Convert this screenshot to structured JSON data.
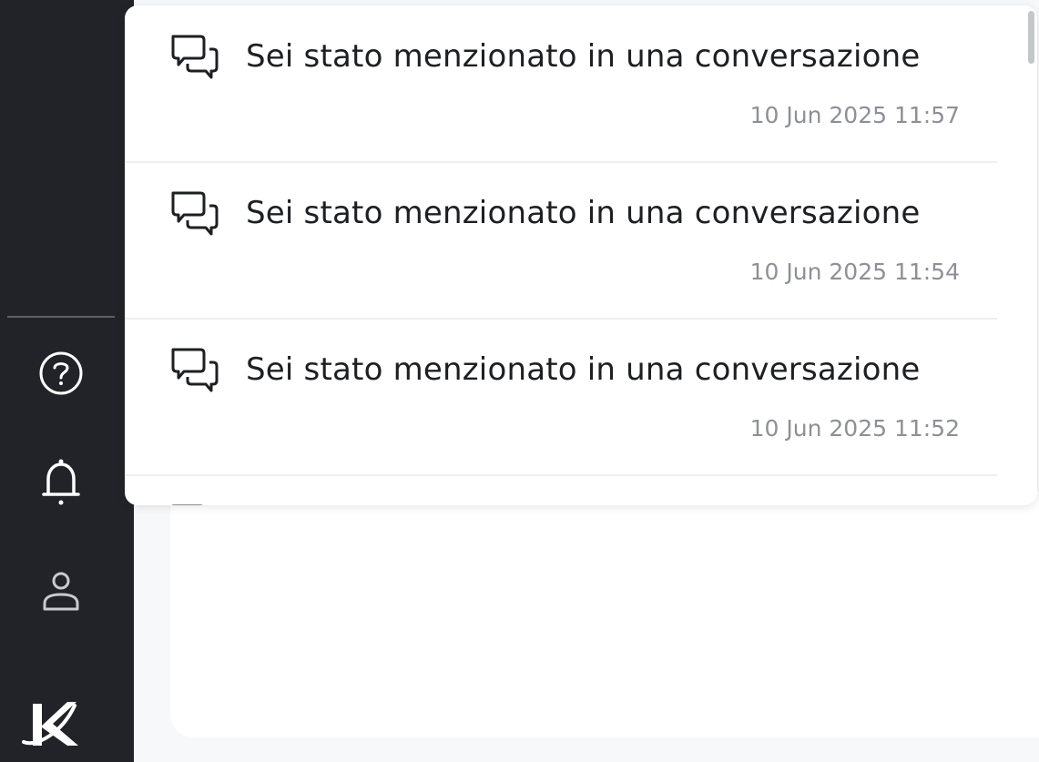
{
  "sidebar": {
    "help_icon": "help-circle-icon",
    "notifications_icon": "bell-icon",
    "profile_icon": "user-icon",
    "logo": "brand-logo"
  },
  "notifications": {
    "items": [
      {
        "icon": "chat-bubbles-icon",
        "title": "Sei stato menzionato in una conversazione",
        "time": "10 Jun 2025 11:57"
      },
      {
        "icon": "chat-bubbles-icon",
        "title": "Sei stato menzionato in una conversazione",
        "time": "10 Jun 2025 11:54"
      },
      {
        "icon": "chat-bubbles-icon",
        "title": "Sei stato menzionato in una conversazione",
        "time": "10 Jun 2025 11:52"
      }
    ]
  },
  "colors": {
    "sidebar_bg": "#212328",
    "panel_bg": "#ffffff",
    "text": "#1d1f23",
    "timestamp": "#8d9096",
    "page_bg": "#f7f8fa"
  }
}
